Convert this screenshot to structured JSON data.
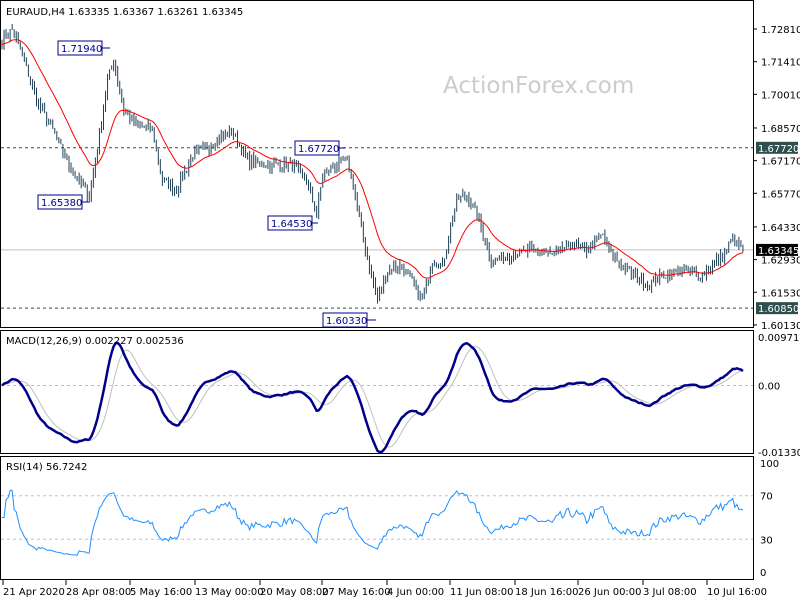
{
  "chart_data": [
    {
      "type": "ohlc",
      "title": "EURAUD,H4",
      "ohlc_readout": [
        "1.63335",
        "1.63367",
        "1.63261",
        "1.63345"
      ],
      "watermark": "ActionForex.com",
      "y_ticks": [
        "1.72810",
        "1.71410",
        "1.70010",
        "1.68570",
        "1.67170",
        "1.65770",
        "1.64330",
        "1.62930",
        "1.61530",
        "1.60130"
      ],
      "ylim": [
        1.6013,
        1.7281
      ],
      "moving_average_color": "#ff0000",
      "bar_color": "#1f3f55",
      "close_keypoints": {
        "bar": [
          0,
          5,
          10,
          17,
          25,
          34,
          43,
          47,
          52,
          55,
          60,
          66,
          74,
          79,
          86,
          94,
          103,
          113,
          121,
          131,
          143,
          150,
          155,
          158,
          165,
          170,
          173,
          178,
          185,
          190,
          197,
          207,
          212,
          217,
          224,
          229,
          234,
          241,
          251,
          261,
          271,
          281,
          288,
          296,
          300,
          308,
          318,
          325,
          335,
          345,
          355,
          360,
          365
        ],
        "close": [
          1.7234,
          1.7277,
          1.717,
          1.6977,
          1.6848,
          1.6677,
          1.657,
          1.6763,
          1.7062,
          1.7148,
          1.6934,
          1.687,
          1.6848,
          1.6634,
          1.6591,
          1.6741,
          1.6784,
          1.6848,
          1.672,
          1.6698,
          1.6698,
          1.6634,
          1.6484,
          1.6656,
          1.6698,
          1.672,
          1.6613,
          1.6377,
          1.612,
          1.6248,
          1.627,
          1.612,
          1.6291,
          1.627,
          1.6548,
          1.657,
          1.6484,
          1.6291,
          1.6313,
          1.6334,
          1.6313,
          1.6356,
          1.6334,
          1.6398,
          1.6313,
          1.6248,
          1.6184,
          1.6227,
          1.6248,
          1.6227,
          1.6313,
          1.6377,
          1.6334
        ]
      },
      "annotations": [
        "1.71940",
        "1.65380",
        "1.64530",
        "1.67720",
        "1.60330"
      ],
      "levels": [
        {
          "value": "1.67720",
          "style": "dashed",
          "badge_color": "#2f4f4f"
        },
        {
          "value": "1.60850",
          "style": "dashed",
          "badge_color": "#2f4f4f"
        },
        {
          "value": "1.63345",
          "style": "solid",
          "badge_color": "#000000",
          "note": "current price"
        }
      ]
    },
    {
      "type": "line",
      "title": "MACD(12,26,9) 0.002227 0.002536",
      "y_ticks": [
        "0.009713",
        "0.00",
        "-0.013302"
      ],
      "ylim": [
        -0.013302,
        0.009713
      ],
      "series_colors": {
        "macd": "#00008b",
        "signal": "#c0c0c0"
      }
    },
    {
      "type": "line",
      "title": "RSI(14) 56.7242",
      "y_ticks": [
        "100",
        "70",
        "30",
        "0"
      ],
      "ylim": [
        0,
        100
      ],
      "levels": [
        70,
        30
      ],
      "line_color": "#1e90ff"
    }
  ],
  "x_ticks": [
    "21 Apr 2020",
    "28 Apr 08:00",
    "5 May 16:00",
    "13 May 00:00",
    "20 May 08:00",
    "27 May 16:00",
    "4 Jun 00:00",
    "11 Jun 08:00",
    "18 Jun 16:00",
    "26 Jun 00:00",
    "3 Jul 08:00",
    "10 Jul 16:00"
  ]
}
